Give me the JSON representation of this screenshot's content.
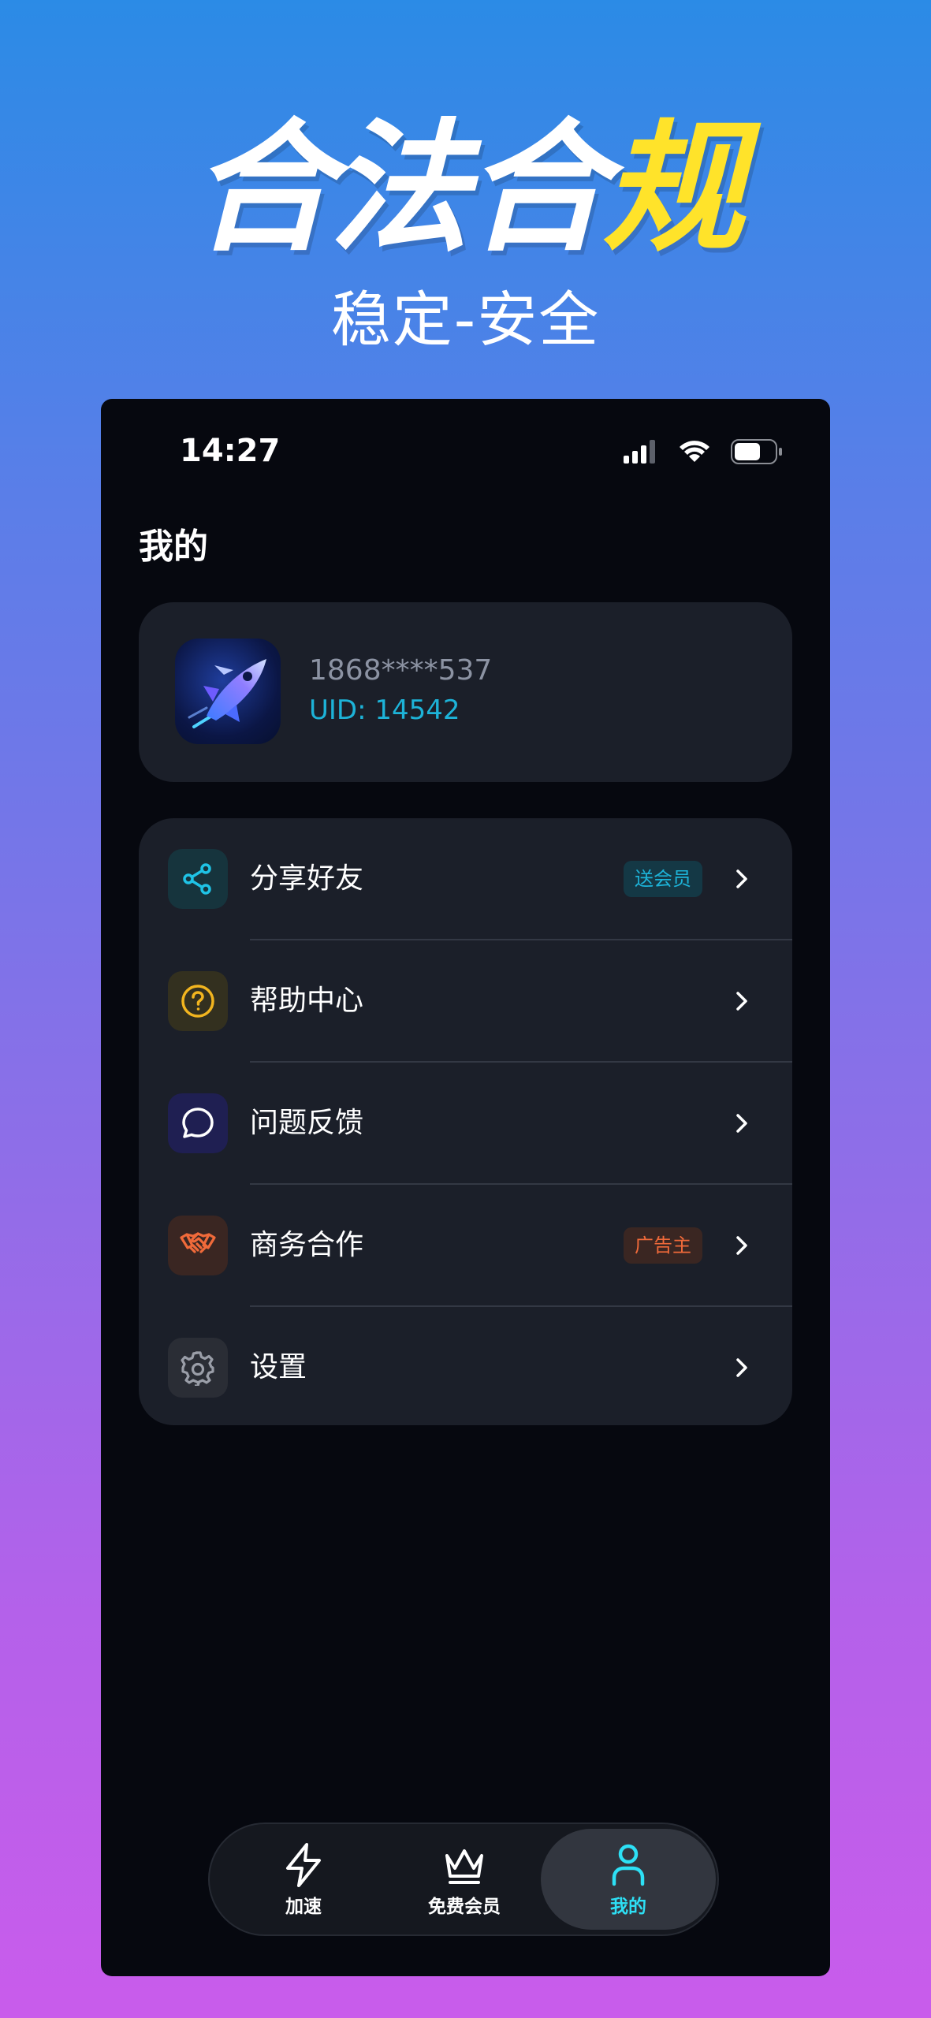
{
  "promo": {
    "title_part1": "合法",
    "title_part2": "合",
    "title_part3": "规",
    "title_chars": [
      "合",
      "法",
      "合",
      "规"
    ],
    "subtitle": "稳定-安全",
    "colors": {
      "white": "#FFFFFF",
      "yellow": "#FFE32A"
    }
  },
  "status_bar": {
    "time": "14:27",
    "icons": [
      "cellular-signal-icon",
      "wifi-icon",
      "battery-icon"
    ]
  },
  "page": {
    "title": "我的"
  },
  "profile": {
    "phone": "1868****537",
    "uid": "UID: 14542",
    "avatar_icon": "rocket-app-logo"
  },
  "menu": [
    {
      "label": "分享好友",
      "icon": "share-icon",
      "badge": "送会员",
      "badge_color": "#1DB3D8"
    },
    {
      "label": "帮助中心",
      "icon": "help-circle-icon"
    },
    {
      "label": "问题反馈",
      "icon": "chat-bubble-icon"
    },
    {
      "label": "商务合作",
      "icon": "handshake-icon",
      "badge": "广告主",
      "badge_color": "#F06A3A"
    },
    {
      "label": "设置",
      "icon": "gear-icon"
    }
  ],
  "tabbar": {
    "items": [
      {
        "label": "加速",
        "icon": "lightning-icon",
        "active": false
      },
      {
        "label": "免费会员",
        "icon": "crown-icon",
        "active": false
      },
      {
        "label": "我的",
        "icon": "person-icon",
        "active": true
      }
    ],
    "active_color": "#2DE0F5"
  }
}
